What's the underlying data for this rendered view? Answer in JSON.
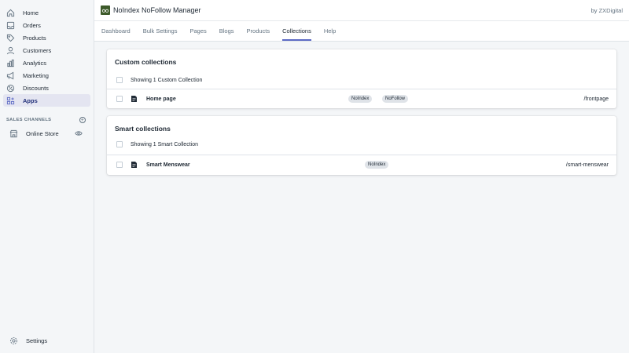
{
  "sidebar": {
    "items": [
      {
        "label": "Home",
        "icon": "home-icon"
      },
      {
        "label": "Orders",
        "icon": "orders-icon"
      },
      {
        "label": "Products",
        "icon": "tag-icon"
      },
      {
        "label": "Customers",
        "icon": "person-icon"
      },
      {
        "label": "Analytics",
        "icon": "bar-chart-icon"
      },
      {
        "label": "Marketing",
        "icon": "megaphone-icon"
      },
      {
        "label": "Discounts",
        "icon": "discount-icon"
      },
      {
        "label": "Apps",
        "icon": "apps-icon",
        "active": true
      }
    ],
    "sales_channels_header": "SALES CHANNELS",
    "online_store": "Online Store",
    "settings": "Settings"
  },
  "topbar": {
    "app_title": "NoIndex NoFollow Manager",
    "by": "by ZXDigital"
  },
  "tabs": [
    {
      "label": "Dashboard"
    },
    {
      "label": "Bulk Settings"
    },
    {
      "label": "Pages"
    },
    {
      "label": "Blogs"
    },
    {
      "label": "Products"
    },
    {
      "label": "Collections",
      "active": true
    },
    {
      "label": "Help"
    }
  ],
  "custom_collections": {
    "title": "Custom collections",
    "showing": "Showing 1 Custom Collection",
    "items": [
      {
        "name": "Home page",
        "badges": [
          "NoIndex",
          "NoFollow"
        ],
        "handle": "/frontpage"
      }
    ]
  },
  "smart_collections": {
    "title": "Smart collections",
    "showing": "Showing 1 Smart Collection",
    "items": [
      {
        "name": "Smart Menswear",
        "badges": [
          "NoIndex"
        ],
        "handle": "/smart-menswear"
      }
    ]
  },
  "colors": {
    "accent": "#5c6ac4",
    "active_bg": "#e4e5f1",
    "badge_bg": "#dfe3e8"
  }
}
